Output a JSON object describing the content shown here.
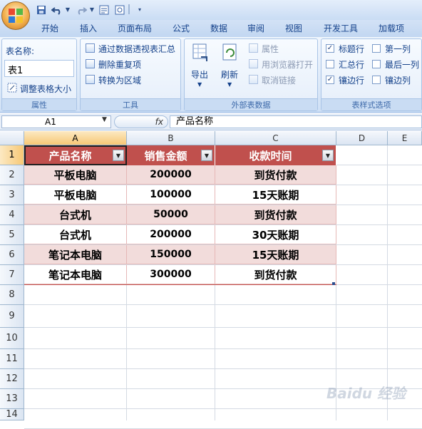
{
  "qat": {
    "undo_icon": "undo-icon",
    "redo_icon": "redo-icon"
  },
  "tabs": [
    "开始",
    "插入",
    "页面布局",
    "公式",
    "数据",
    "审阅",
    "视图",
    "开发工具",
    "加载项"
  ],
  "ribbon": {
    "properties": {
      "table_name_label": "表名称:",
      "table_name_value": "表1",
      "resize_label": "调整表格大小",
      "group_title": "属性"
    },
    "tools": {
      "pivot_label": "通过数据透视表汇总",
      "remove_dup_label": "删除重复项",
      "convert_label": "转换为区域",
      "group_title": "工具"
    },
    "external": {
      "export_label": "导出",
      "refresh_label": "刷新",
      "properties_label": "属性",
      "browser_label": "用浏览器打开",
      "unlink_label": "取消链接",
      "group_title": "外部表数据"
    },
    "style_options": {
      "header_row": {
        "label": "标题行",
        "checked": true
      },
      "total_row": {
        "label": "汇总行",
        "checked": false
      },
      "banded_rows": {
        "label": "镶边行",
        "checked": true
      },
      "first_col": {
        "label": "第一列",
        "checked": false
      },
      "last_col": {
        "label": "最后一列",
        "checked": false
      },
      "banded_cols": {
        "label": "镶边列",
        "checked": false
      },
      "group_title": "表样式选项"
    }
  },
  "formula_bar": {
    "name_box": "A1",
    "fx": "fx",
    "content": "产品名称"
  },
  "columns": [
    "A",
    "B",
    "C",
    "D",
    "E"
  ],
  "rows": [
    "1",
    "2",
    "3",
    "4",
    "5",
    "6",
    "7",
    "8",
    "9",
    "10",
    "11",
    "12",
    "13",
    "14"
  ],
  "table": {
    "headers": [
      "产品名称",
      "销售金额",
      "收款时间"
    ],
    "rows": [
      [
        "平板电脑",
        "200000",
        "到货付款"
      ],
      [
        "平板电脑",
        "100000",
        "15天账期"
      ],
      [
        "台式机",
        "50000",
        "到货付款"
      ],
      [
        "台式机",
        "200000",
        "30天账期"
      ],
      [
        "笔记本电脑",
        "150000",
        "15天账期"
      ],
      [
        "笔记本电脑",
        "300000",
        "到货付款"
      ]
    ],
    "header_color": "#c0504d",
    "band_color": "#f2dcdb"
  },
  "watermark": "Baidu 经验"
}
